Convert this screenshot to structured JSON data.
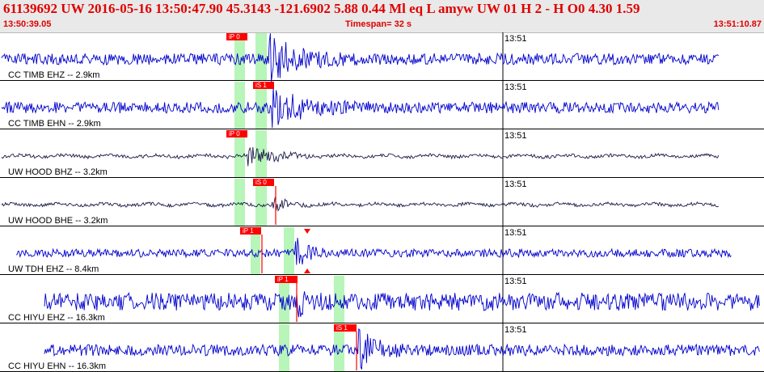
{
  "header": {
    "event_line": "61139692 UW 2016-05-16 13:50:47.90   45.3143 -121.6902   5.88  0.44 Ml  eq  L amyw     UW 01  H   2  -  H O0     4.30  1.59",
    "start_time": "13:50:39.05",
    "timespan": "Timespan=  32 s",
    "end_time": "13:51:10.87"
  },
  "colors": {
    "trace": "#0000cc",
    "trace_dark": "#1a1a4a",
    "pick": "#ff0000",
    "window": "#b8f5b8",
    "header_text": "#e00000",
    "header_bg": "#e9e9e9"
  },
  "minute_mark": "13:51",
  "channels": [
    {
      "label": "CC TIMB EHZ -- 2.9km",
      "picks": [
        {
          "text": "iP 0"
        }
      ]
    },
    {
      "label": "CC TIMB EHN -- 2.9km",
      "picks": [
        {
          "text": "iS 1"
        }
      ]
    },
    {
      "label": "UW HOOD BHZ -- 3.2km",
      "picks": [
        {
          "text": "iP 0"
        }
      ]
    },
    {
      "label": "UW HOOD BHE -- 3.2km",
      "picks": [
        {
          "text": "iS 0"
        }
      ]
    },
    {
      "label": "UW TDH EHZ -- 8.4km",
      "picks": [
        {
          "text": "iP 1"
        }
      ]
    },
    {
      "label": "CC HIYU EHZ -- 16.3km",
      "picks": [
        {
          "text": "iP 1"
        }
      ]
    },
    {
      "label": "CC HIYU EHN -- 16.3km",
      "picks": [
        {
          "text": "iS 1"
        }
      ]
    }
  ]
}
